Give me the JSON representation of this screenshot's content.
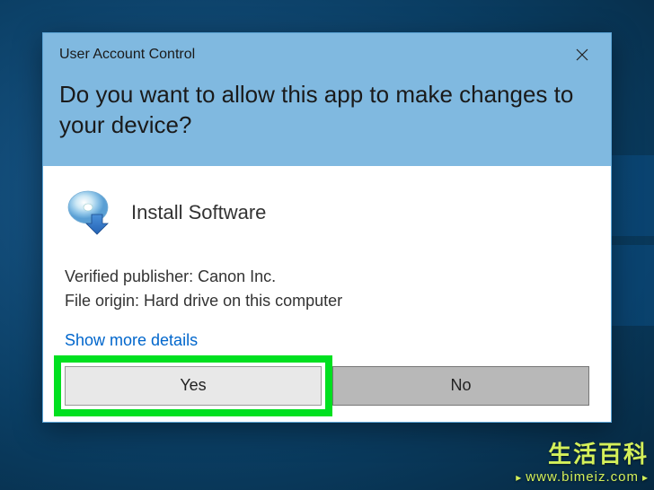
{
  "dialog": {
    "title": "User Account Control",
    "headline": "Do you want to allow this app to make changes to your device?",
    "app_name": "Install Software",
    "publisher_label": "Verified publisher:",
    "publisher_value": "Canon Inc.",
    "origin_label": "File origin:",
    "origin_value": "Hard drive on this computer",
    "more_details": "Show more details",
    "yes_label": "Yes",
    "no_label": "No"
  },
  "watermark": {
    "top": "生活百科",
    "bottom": "www.bimeiz.com"
  },
  "highlight": {
    "target": "yes-button"
  },
  "colors": {
    "header_bg": "#80b9e0",
    "link": "#0066cc",
    "highlight": "#00e020"
  }
}
